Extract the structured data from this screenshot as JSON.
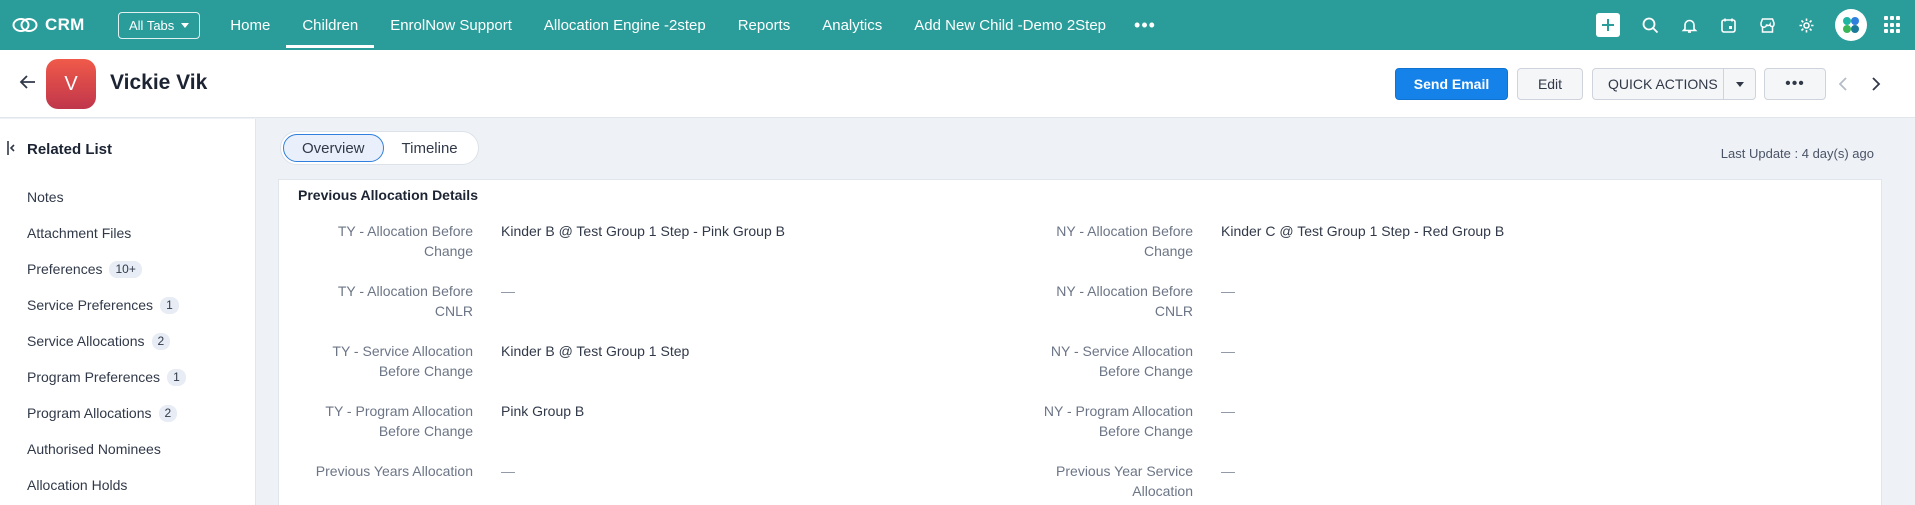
{
  "topbar": {
    "brand": "CRM",
    "all_tabs": "All Tabs",
    "tabs": [
      "Home",
      "Children",
      "EnrolNow Support",
      "Allocation Engine -2step",
      "Reports",
      "Analytics",
      "Add New Child -Demo 2Step"
    ],
    "active_tab": "Children",
    "accent_color": "#2a9d9a"
  },
  "record": {
    "initial": "V",
    "name": "Vickie Vik",
    "send_email": "Send Email",
    "edit": "Edit",
    "quick_actions": "QUICK ACTIONS"
  },
  "sidebar": {
    "title": "Related List",
    "items": [
      {
        "label": "Notes",
        "badge": ""
      },
      {
        "label": "Attachment Files",
        "badge": ""
      },
      {
        "label": "Preferences",
        "badge": "10+"
      },
      {
        "label": "Service Preferences",
        "badge": "1"
      },
      {
        "label": "Service Allocations",
        "badge": "2"
      },
      {
        "label": "Program Preferences",
        "badge": "1"
      },
      {
        "label": "Program Allocations",
        "badge": "2"
      },
      {
        "label": "Authorised Nominees",
        "badge": ""
      },
      {
        "label": "Allocation Holds",
        "badge": ""
      }
    ]
  },
  "main": {
    "tabs": [
      "Overview",
      "Timeline"
    ],
    "active_tab": "Overview",
    "last_update": "Last Update : 4 day(s) ago",
    "section_title": "Previous Allocation Details",
    "left_fields": [
      {
        "label_1": "TY - Allocation Before",
        "label_2": "Change",
        "value": "Kinder B @ Test Group 1 Step - Pink Group B"
      },
      {
        "label_1": "TY - Allocation Before",
        "label_2": "CNLR",
        "value": "—"
      },
      {
        "label_1": "TY - Service Allocation",
        "label_2": "Before Change",
        "value": "Kinder B @ Test Group 1 Step"
      },
      {
        "label_1": "TY - Program Allocation",
        "label_2": "Before Change",
        "value": "Pink Group B"
      },
      {
        "label_1": "Previous Years Allocation",
        "label_2": "",
        "value": "—"
      }
    ],
    "right_fields": [
      {
        "label_1": "NY - Allocation Before",
        "label_2": "Change",
        "value": "Kinder C @ Test Group 1 Step - Red Group B"
      },
      {
        "label_1": "NY - Allocation Before",
        "label_2": "CNLR",
        "value": "—"
      },
      {
        "label_1": "NY - Service Allocation",
        "label_2": "Before Change",
        "value": "—"
      },
      {
        "label_1": "NY - Program Allocation",
        "label_2": "Before Change",
        "value": "—"
      },
      {
        "label_1": "Previous Year Service",
        "label_2": "Allocation",
        "value": "—"
      }
    ]
  }
}
